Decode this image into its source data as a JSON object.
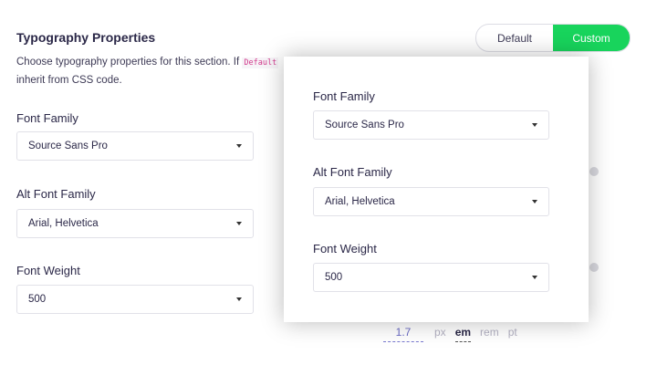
{
  "panel": {
    "title": "Typography Properties",
    "description_start": "Choose typography properties for this section. If",
    "description_code": "Default",
    "description_end": "inherit from CSS code.",
    "toggle": {
      "default_label": "Default",
      "custom_label": "Custom",
      "selected": "Custom"
    },
    "font_family_label": "Font Family",
    "font_family_value": "Source Sans Pro",
    "alt_font_family_label": "Alt Font Family",
    "alt_font_family_value": "Arial, Helvetica",
    "font_weight_label": "Font Weight",
    "font_weight_value": "500",
    "line_height_value": "1.7",
    "units": [
      "px",
      "em",
      "rem",
      "pt"
    ],
    "active_unit": "em"
  },
  "popup": {
    "font_family_label": "Font Family",
    "font_family_value": "Source Sans Pro",
    "alt_font_family_label": "Alt Font Family",
    "alt_font_family_value": "Arial, Helvetica",
    "font_weight_label": "Font Weight",
    "font_weight_value": "500"
  },
  "colors": {
    "accent_green": "#18d45c",
    "text_dark": "#2b2848",
    "code_pink": "#d23a8c"
  },
  "icons": {
    "dropdown": "chevron-down-icon"
  }
}
